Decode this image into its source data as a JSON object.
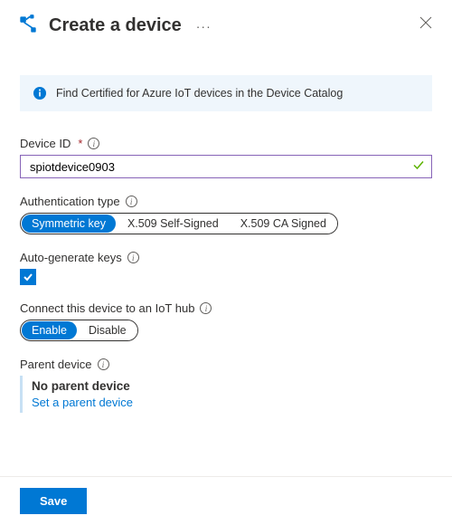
{
  "header": {
    "title": "Create a device"
  },
  "infoBar": {
    "text": "Find Certified for Azure IoT devices in the Device Catalog"
  },
  "deviceId": {
    "label": "Device ID",
    "value": "spiotdevice0903"
  },
  "authType": {
    "label": "Authentication type",
    "options": {
      "symmetric": "Symmetric key",
      "selfSigned": "X.509 Self-Signed",
      "caSigned": "X.509 CA Signed"
    },
    "selected": "symmetric"
  },
  "autoGen": {
    "label": "Auto-generate keys",
    "checked": true
  },
  "connectHub": {
    "label": "Connect this device to an IoT hub",
    "options": {
      "enable": "Enable",
      "disable": "Disable"
    },
    "selected": "enable"
  },
  "parentDevice": {
    "label": "Parent device",
    "noneText": "No parent device",
    "linkText": "Set a parent device"
  },
  "footer": {
    "save": "Save"
  }
}
